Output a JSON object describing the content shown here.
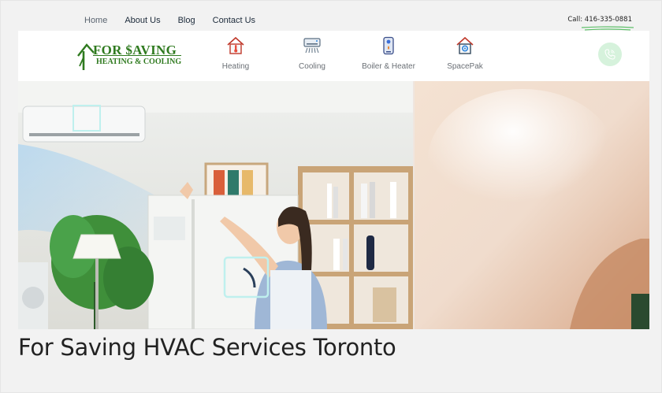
{
  "topnav": {
    "items": [
      {
        "label": "Home",
        "active": true
      },
      {
        "label": "About Us"
      },
      {
        "label": "Blog"
      },
      {
        "label": "Contact Us"
      }
    ],
    "call_prefix": "Call: ",
    "call_number": "416-335-0881"
  },
  "logo": {
    "main": "FOR $AVING",
    "sub": "HEATING & COOLING",
    "color": "#2f7a1f"
  },
  "services": [
    {
      "label": "Heating",
      "icon": "house-thermometer-icon"
    },
    {
      "label": "Cooling",
      "icon": "air-conditioner-icon"
    },
    {
      "label": "Boiler & Heater",
      "icon": "water-heater-icon"
    },
    {
      "label": "SpacePak",
      "icon": "house-gear-icon"
    }
  ],
  "phone_button": {
    "icon": "phone-icon",
    "color": "#d6f2dc"
  },
  "hero": {
    "image": "woman-using-smart-air-conditioner-photo"
  },
  "caption": "For Saving HVAC Services Toronto"
}
